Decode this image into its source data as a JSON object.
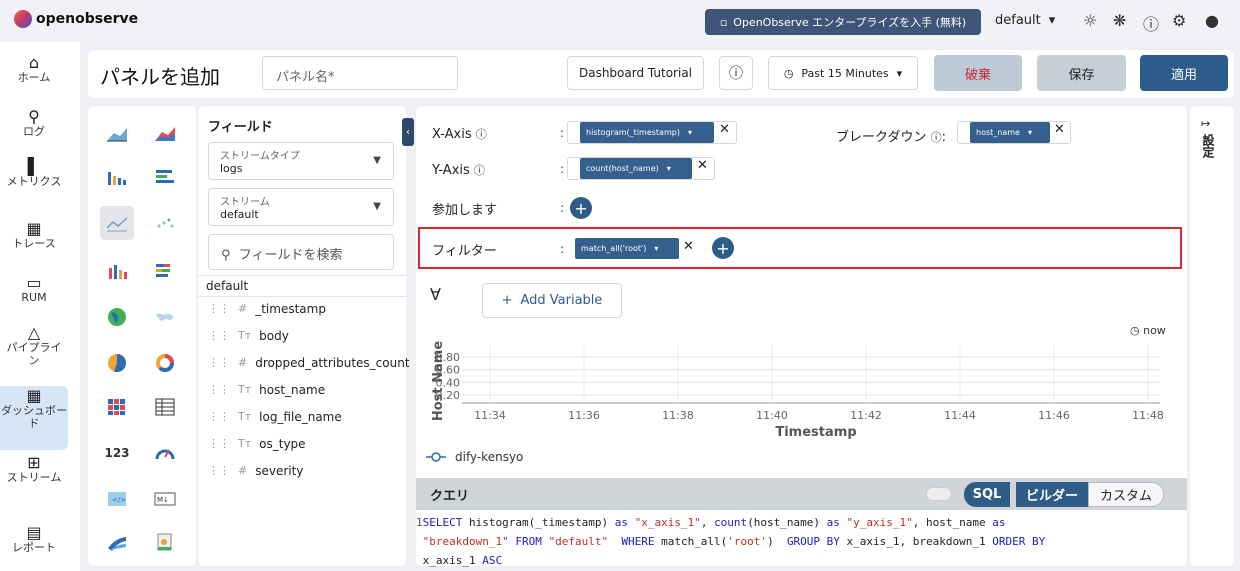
{
  "app": {
    "logo": "openobserve",
    "enterprise_btn": "OpenObserve エンタープライズを入手 (無料)",
    "org": "default"
  },
  "nav": [
    {
      "label": "ホーム",
      "icon": "home-icon"
    },
    {
      "label": "ログ",
      "icon": "search-icon"
    },
    {
      "label": "メトリクス",
      "icon": "bar-chart-icon"
    },
    {
      "label": "トレース",
      "icon": "trace-icon"
    },
    {
      "label": "RUM",
      "icon": "monitor-icon"
    },
    {
      "label": "パイプライン",
      "icon": "pipeline-icon"
    },
    {
      "label": "ダッシュボード",
      "icon": "dashboard-icon"
    },
    {
      "label": "ストリーム",
      "icon": "grid-icon"
    },
    {
      "label": "レポート",
      "icon": "report-icon"
    }
  ],
  "header": {
    "title": "パネルを追加",
    "panel_name_placeholder": "パネル名*",
    "tutorial": "Dashboard Tutorial",
    "time": "Past 15 Minutes",
    "discard": "破棄",
    "save": "保存",
    "apply": "適用"
  },
  "fields": {
    "title": "フィールド",
    "stream_type_label": "ストリームタイプ",
    "stream_type": "logs",
    "stream_label": "ストリーム",
    "stream": "default",
    "search_placeholder": "フィールドを検索",
    "source": "default",
    "items": [
      {
        "type": "#",
        "name": "_timestamp"
      },
      {
        "type": "Tт",
        "name": "body"
      },
      {
        "type": "#",
        "name": "dropped_attributes_count"
      },
      {
        "type": "Tт",
        "name": "host_name"
      },
      {
        "type": "Tт",
        "name": "log_file_name"
      },
      {
        "type": "Tт",
        "name": "os_type"
      },
      {
        "type": "#",
        "name": "severity"
      }
    ]
  },
  "config": {
    "x_axis": "X-Axis",
    "x_chip": "histogram(_timestamp)",
    "breakdown": "ブレークダウン",
    "breakdown_chip": "host_name",
    "y_axis": "Y-Axis",
    "y_chip": "count(host_name)",
    "join": "参加します",
    "filter": "フィルター",
    "filter_chip": "match_all('root')",
    "add_variable": "Add Variable",
    "now": "now"
  },
  "chart_data": {
    "type": "line",
    "xlabel": "Timestamp",
    "ylabel": "Host Name",
    "x_ticks": [
      "11:34",
      "11:36",
      "11:38",
      "11:40",
      "11:42",
      "11:44",
      "11:46",
      "11:48"
    ],
    "y_ticks": [
      "0.80",
      "0.60",
      "0.40",
      "0.20"
    ],
    "series": [
      {
        "name": "dify-kensyo",
        "values": []
      }
    ]
  },
  "query": {
    "title": "クエリ",
    "sql": "SQL",
    "builder": "ビルダー",
    "custom": "カスタム",
    "line_no": "1"
  },
  "settings": {
    "label": "設定"
  }
}
